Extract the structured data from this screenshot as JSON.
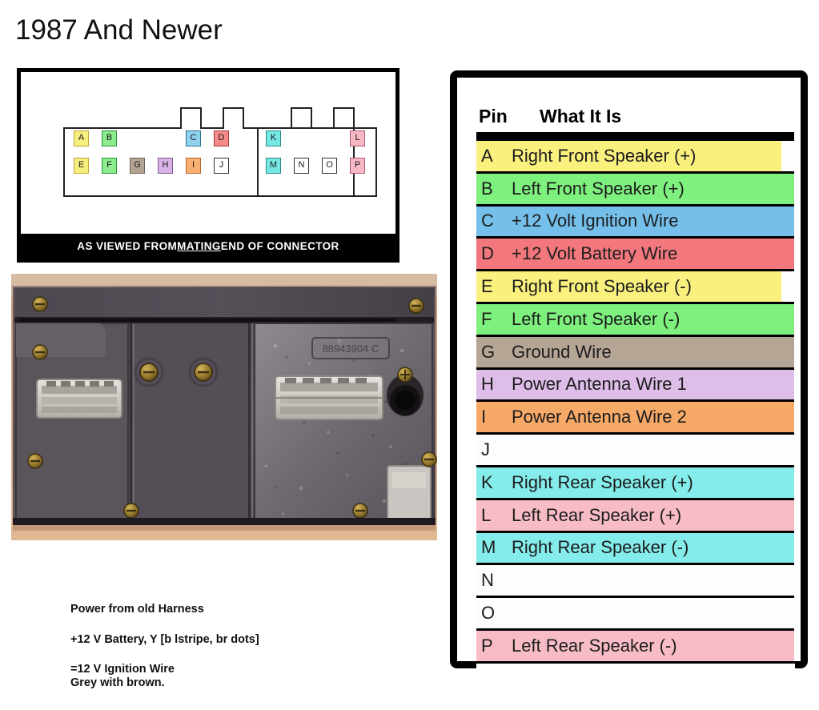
{
  "page": {
    "title": "1987 And Newer"
  },
  "connector_diagram": {
    "caption_prefix": "AS VIEWED FROM ",
    "caption_underlined": "MATING",
    "caption_suffix": " END OF CONNECTOR",
    "left_connector": {
      "name": "left-connector",
      "top_row": [
        {
          "label": "A",
          "color": "#f5ef7d",
          "border": "#c9a23a"
        },
        {
          "label": "B",
          "color": "#8ceb8c",
          "border": "#2e8f3a"
        },
        {
          "label": "",
          "color": "",
          "border": ""
        },
        {
          "label": "",
          "color": "",
          "border": ""
        },
        {
          "label": "C",
          "color": "#8fd2f0",
          "border": "#2f6e8f"
        },
        {
          "label": "D",
          "color": "#f58a8a",
          "border": "#a33a3a"
        }
      ],
      "bottom_row": [
        {
          "label": "E",
          "color": "#f5ef7d",
          "border": "#c9a23a"
        },
        {
          "label": "F",
          "color": "#8ceb8c",
          "border": "#2e8f3a"
        },
        {
          "label": "G",
          "color": "#b3a391",
          "border": "#6e6055"
        },
        {
          "label": "H",
          "color": "#d9b3e6",
          "border": "#7a5a8c"
        },
        {
          "label": "I",
          "color": "#f7b071",
          "border": "#b8692a"
        },
        {
          "label": "J",
          "color": "#ffffff",
          "border": "#333333"
        }
      ]
    },
    "right_connector": {
      "name": "right-connector",
      "top_row": [
        {
          "label": "K",
          "color": "#75e8e3",
          "border": "#2a8a86"
        },
        {
          "label": "",
          "color": "",
          "border": ""
        },
        {
          "label": "",
          "color": "",
          "border": ""
        },
        {
          "label": "L",
          "color": "#f6b8c4",
          "border": "#b05a6d"
        }
      ],
      "bottom_row": [
        {
          "label": "M",
          "color": "#75e8e3",
          "border": "#2a8a86"
        },
        {
          "label": "N",
          "color": "#ffffff",
          "border": "#333333"
        },
        {
          "label": "O",
          "color": "#ffffff",
          "border": "#333333"
        },
        {
          "label": "P",
          "color": "#f6b8c4",
          "border": "#b05a6d"
        }
      ]
    }
  },
  "photo": {
    "alt": "Rear view of car radio chassis showing two white wiring connectors, antenna jack and mounting screws",
    "part_label": "88943904 C"
  },
  "pin_table": {
    "header": {
      "pin": "Pin",
      "what_it_is": "What It Is"
    },
    "rows": [
      {
        "pin": "A",
        "desc": "Right Front Speaker (+)",
        "color": "#f9f07e",
        "short": true
      },
      {
        "pin": "B",
        "desc": "Left Front Speaker (+)",
        "color": "#7ef07e",
        "short": false
      },
      {
        "pin": "C",
        "desc": "+12 Volt Ignition Wire",
        "color": "#75c0ea",
        "short": false
      },
      {
        "pin": "D",
        "desc": "+12 Volt Battery Wire",
        "color": "#f2787e",
        "short": false
      },
      {
        "pin": "E",
        "desc": "Right Front Speaker (-)",
        "color": "#f9f07e",
        "short": true
      },
      {
        "pin": "F",
        "desc": "Left Front Speaker (-)",
        "color": "#7ef07e",
        "short": false
      },
      {
        "pin": "G",
        "desc": "Ground Wire",
        "color": "#b5a595",
        "short": false
      },
      {
        "pin": "H",
        "desc": "Power Antenna Wire 1",
        "color": "#debde8",
        "short": false
      },
      {
        "pin": "I",
        "desc": "Power Antenna Wire 2",
        "color": "#f7a968",
        "short": false
      },
      {
        "pin": "J",
        "desc": "",
        "color": "#fdfdfd",
        "short": false
      },
      {
        "pin": "K",
        "desc": "Right Rear Speaker (+)",
        "color": "#84ecea",
        "short": false
      },
      {
        "pin": "L",
        "desc": "Left Rear Speaker (+)",
        "color": "#f7bcc6",
        "short": false
      },
      {
        "pin": "M",
        "desc": "Right Rear Speaker (-)",
        "color": "#84ecea",
        "short": false
      },
      {
        "pin": "N",
        "desc": "",
        "color": "#fdfdfd",
        "short": false
      },
      {
        "pin": "O",
        "desc": "",
        "color": "#fdfdfd",
        "short": false
      },
      {
        "pin": "P",
        "desc": "Left Rear Speaker (-)",
        "color": "#f7bcc6",
        "short": false
      }
    ]
  },
  "notes": {
    "line1": "Power from old Harness",
    "line2": "+12 V Battery, Y [b lstripe, br dots]",
    "line3": "=12 V Ignition Wire",
    "line4": "Grey with brown."
  }
}
